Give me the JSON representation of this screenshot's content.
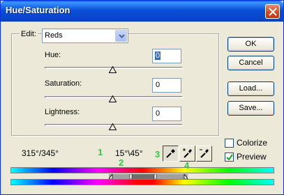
{
  "window": {
    "title": "Hue/Saturation"
  },
  "edit": {
    "label": "Edit:",
    "selected": "Reds"
  },
  "sliders": {
    "hue": {
      "label": "Hue:",
      "value": "0"
    },
    "saturation": {
      "label": "Saturation:",
      "value": "0"
    },
    "lightness": {
      "label": "Lightness:",
      "value": "0"
    }
  },
  "buttons": {
    "ok": "OK",
    "cancel": "Cancel",
    "load": "Load...",
    "save": "Save..."
  },
  "options": {
    "colorize": {
      "label": "Colorize",
      "checked": false
    },
    "preview": {
      "label": "Preview",
      "checked": true
    }
  },
  "range": {
    "left": "315°/345°",
    "right": "15°\\45°"
  },
  "annotations": [
    "1",
    "2",
    "3",
    "4"
  ],
  "icons": [
    "close-icon",
    "chevron-down-icon",
    "eyedropper-icon",
    "eyedropper-plus-icon",
    "eyedropper-minus-icon"
  ],
  "colors": {
    "titlebar": "#0845c8",
    "selection": "#316ac5",
    "annotation": "#2ecc40"
  }
}
